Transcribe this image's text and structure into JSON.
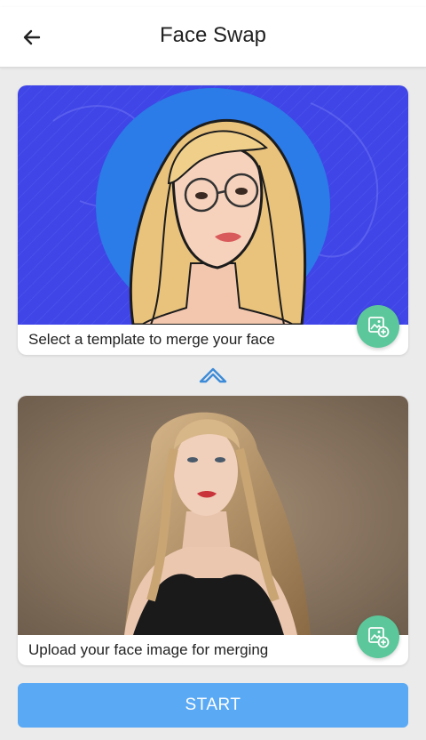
{
  "header": {
    "title": "Face Swap",
    "back_icon": "arrow-left-icon"
  },
  "template_card": {
    "caption": "Select a template to merge your face",
    "add_icon": "add-image-icon",
    "background_color": "#3f45e6",
    "circle_color": "#2b7be8"
  },
  "divider": {
    "icon": "chevron-up-icon",
    "color": "#3d8bd8"
  },
  "upload_card": {
    "caption": "Upload your face image for merging",
    "add_icon": "add-image-icon"
  },
  "start_button": {
    "label": "START",
    "color": "#5aa9f5"
  }
}
